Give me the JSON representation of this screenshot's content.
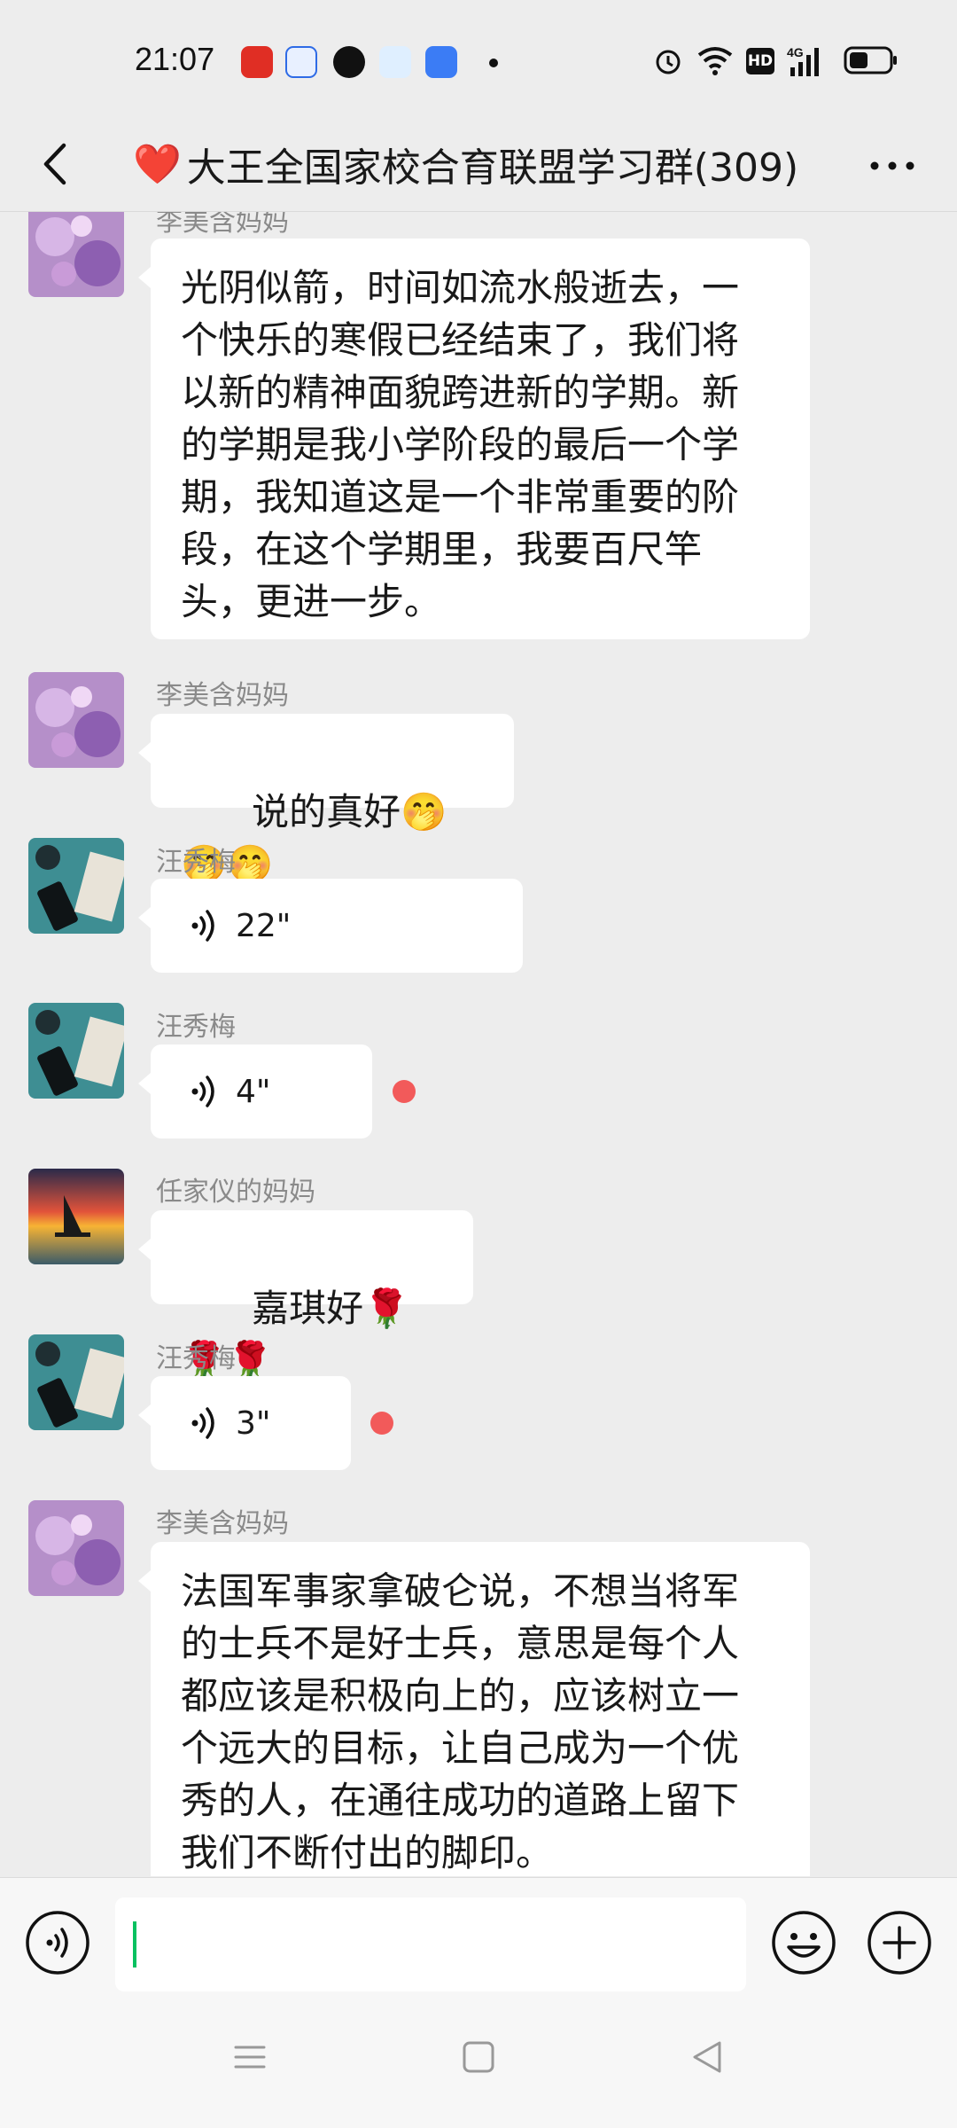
{
  "status_bar": {
    "time": "21:07",
    "app_icons": [
      "pinduoduo-icon",
      "app-icon",
      "quark-icon",
      "app-icon",
      "app-icon"
    ],
    "right_icons": [
      "alarm-icon",
      "wifi-icon",
      "hd-icon",
      "signal-4g-icon",
      "battery-icon"
    ],
    "hd_label": "HD",
    "net_label": "4G"
  },
  "header": {
    "title": "大王全国家校合育联盟学习群(309)",
    "heart": "❤️"
  },
  "messages": [
    {
      "sender": "李美含妈妈",
      "type": "text",
      "text": "光阴似箭，时间如流水般逝去，一\n个快乐的寒假已经结束了，我们将\n以新的精神面貌跨进新的学期。新\n的学期是我小学阶段的最后一个学\n期，我知道这是一个非常重要的阶\n段，在这个学期里，我要百尺竿\n头，更进一步。"
    },
    {
      "sender": "李美含妈妈",
      "type": "text",
      "text": "说的真好",
      "emoji": "🤭🤭🤭"
    },
    {
      "sender": "汪秀梅",
      "type": "voice",
      "duration": "22\""
    },
    {
      "sender": "汪秀梅",
      "type": "voice",
      "duration": "4\"",
      "unread": true
    },
    {
      "sender": "任家仪的妈妈",
      "type": "text",
      "text": "嘉琪好",
      "emoji": "🌹🌹🌹"
    },
    {
      "sender": "汪秀梅",
      "type": "voice",
      "duration": "3\"",
      "unread": true
    },
    {
      "sender": "李美含妈妈",
      "type": "text",
      "text": "法国军事家拿破仑说，不想当将军\n的士兵不是好士兵，意思是每个人\n都应该是积极向上的，应该树立一\n个远大的目标，让自己成为一个优\n秀的人，在通往成功的道路上留下\n我们不断付出的脚印。"
    }
  ],
  "input_bar": {
    "voice_button": "voice-input-icon",
    "input_value": "",
    "emoji_button": "emoji-icon",
    "plus_button": "plus-icon"
  },
  "nav_bar": [
    "menu-icon",
    "home-icon",
    "back-triangle-icon"
  ],
  "colors": {
    "background": "#ededed",
    "bubble": "#ffffff",
    "unread_dot": "#f25a5a",
    "caret": "#07c160"
  }
}
